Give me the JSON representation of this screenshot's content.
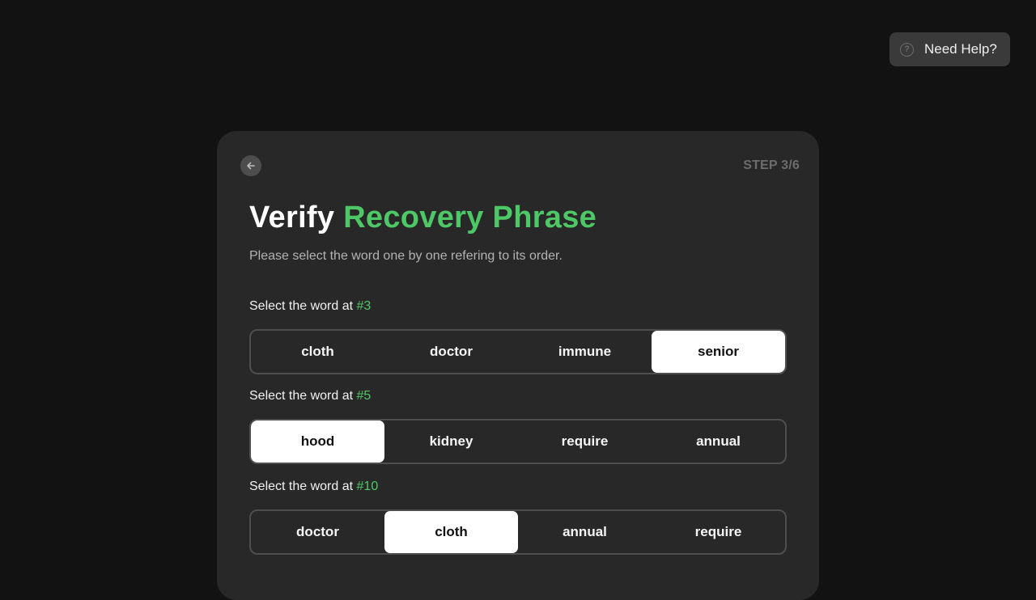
{
  "help": {
    "label": "Need Help?",
    "icon": "question-circle-icon"
  },
  "card": {
    "back_icon": "arrow-left-icon",
    "step": "STEP 3/6",
    "title_part1": "Verify",
    "title_part2": "Recovery Phrase",
    "subtitle": "Please select the word one by one refering to its order."
  },
  "questions": [
    {
      "label": "Select the word at ",
      "number": "#3",
      "options": [
        "cloth",
        "doctor",
        "immune",
        "senior"
      ],
      "selected": "senior"
    },
    {
      "label": "Select the word at ",
      "number": "#5",
      "options": [
        "hood",
        "kidney",
        "require",
        "annual"
      ],
      "selected": "hood"
    },
    {
      "label": "Select the word at ",
      "number": "#10",
      "options": [
        "doctor",
        "cloth",
        "annual",
        "require"
      ],
      "selected": "cloth"
    }
  ],
  "colors": {
    "accent": "#4ec766",
    "background": "#121212",
    "card": "#282828",
    "selected_bg": "#ffffff"
  }
}
